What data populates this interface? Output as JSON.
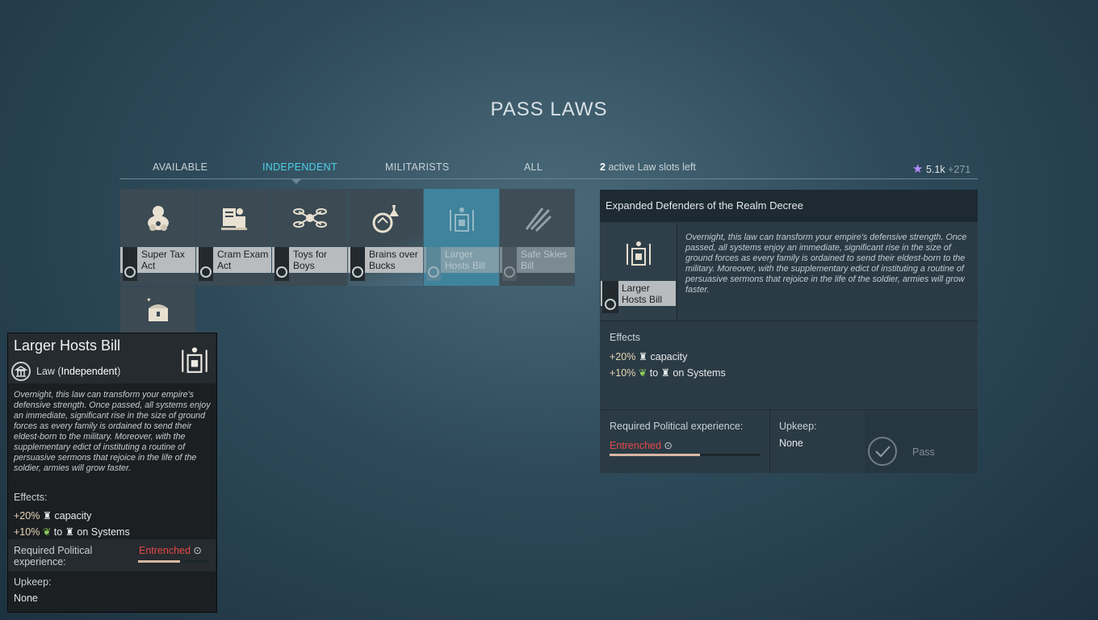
{
  "title": "PASS LAWS",
  "tabs": [
    {
      "label": "AVAILABLE"
    },
    {
      "label": "INDEPENDENT"
    },
    {
      "label": "MILITARISTS"
    },
    {
      "label": "ALL"
    }
  ],
  "slots": {
    "count": "2",
    "text": "active Law slots left"
  },
  "influence": {
    "value": "5.1k",
    "delta": "+271"
  },
  "laws": [
    {
      "line1": "Super Tax",
      "line2": "Act",
      "icon": "piggy-bank-icon"
    },
    {
      "line1": "Cram Exam",
      "line2": "Act",
      "icon": "scientist-icon"
    },
    {
      "line1": "Toys for",
      "line2": "Boys",
      "icon": "drone-icon"
    },
    {
      "line1": "Brains over",
      "line2": "Bucks",
      "icon": "flask-icon"
    },
    {
      "line1": "Larger",
      "line2": "Hosts Bill",
      "icon": "podium-icon"
    },
    {
      "line1": "Safe Skies",
      "line2": "Bill",
      "icon": "missiles-icon"
    },
    {
      "line1": "",
      "line2": "",
      "icon": "treasure-chest-icon"
    }
  ],
  "details": {
    "header": "Expanded Defenders of the Realm Decree",
    "card_line1": "Larger",
    "card_line2": "Hosts Bill",
    "description": "Overnight, this law can transform your empire's defensive strength. Once passed, all systems enjoy an immediate, significant rise in the size of ground forces as every family is ordained to send their eldest-born to the military. Moreover, with the supplementary edict of instituting a routine of persuasive sermons that rejoice in the life of the soldier, armies will grow faster.",
    "effects_label": "Effects",
    "effect1": {
      "value": "+20%",
      "text": "capacity"
    },
    "effect2": {
      "value": "+10%",
      "to": "to",
      "text": "on Systems"
    },
    "required_label": "Required Political experience:",
    "required_value": "Entrenched",
    "required_progress": 0.6,
    "upkeep_label": "Upkeep:",
    "upkeep_value": "None",
    "pass_label": "Pass"
  },
  "tooltip": {
    "title": "Larger Hosts Bill",
    "type": "Law",
    "faction": "Independent",
    "description": "Overnight, this law can transform your empire's defensive strength. Once passed, all systems enjoy an immediate, significant rise in the size of ground forces as every family is ordained to send their eldest-born to the military. Moreover, with the supplementary edict of instituting a routine of persuasive sermons that rejoice in the life of the soldier, armies will grow faster.",
    "effects_label": "Effects:",
    "effect1": {
      "value": "+20%",
      "text": "capacity"
    },
    "effect2": {
      "value": "+10%",
      "to": "to",
      "text": "on Systems"
    },
    "required_label_1": "Required Political",
    "required_label_2": "experience:",
    "required_value": "Entrenched",
    "upkeep_label": "Upkeep:",
    "upkeep_value": "None"
  },
  "colors": {
    "accent": "#4fd0e8",
    "warning": "#e64848",
    "influence": "#b48cff"
  }
}
